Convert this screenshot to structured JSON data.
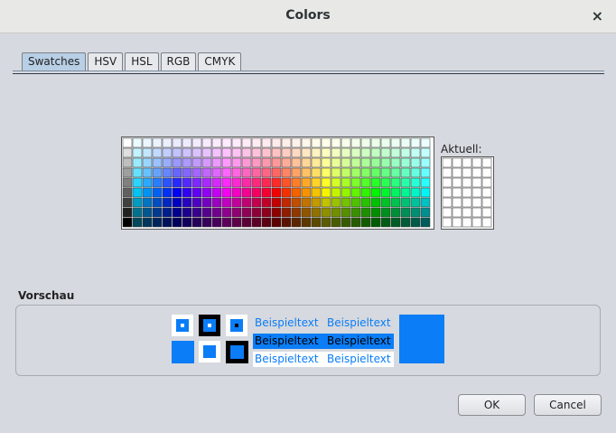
{
  "window": {
    "title": "Colors",
    "close_glyph": "×"
  },
  "tabs": [
    {
      "label": "Swatches",
      "active": true
    },
    {
      "label": "HSV",
      "active": false
    },
    {
      "label": "HSL",
      "active": false
    },
    {
      "label": "RGB",
      "active": false
    },
    {
      "label": "CMYK",
      "active": false
    }
  ],
  "swatches": {
    "columns": 31,
    "rows": 9
  },
  "recent": {
    "label": "Aktuell:",
    "columns": 5,
    "rows": 7,
    "color": "#ffffff"
  },
  "preview": {
    "label": "Vorschau",
    "color": "#0a7df7",
    "sample_text": "Beispieltext"
  },
  "buttons": {
    "ok": "OK",
    "cancel": "Cancel"
  }
}
